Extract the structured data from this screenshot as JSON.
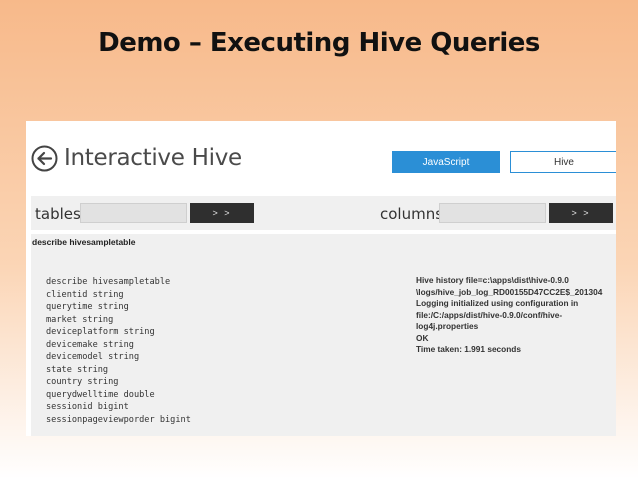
{
  "slide": {
    "title": "Demo – Executing Hive Queries"
  },
  "app": {
    "title": "Interactive Hive",
    "back_icon": "back-arrow-circle-icon",
    "modes": {
      "javascript": "JavaScript",
      "hive": "Hive",
      "selected": "JavaScript"
    },
    "accent_color": "#2b8fd6"
  },
  "toolbar": {
    "tables_label": "tables",
    "tables_value": "",
    "tables_go": "> >",
    "columns_label": "columns",
    "columns_value": "",
    "columns_go": "> >"
  },
  "output": {
    "command": "describe hivesampletable",
    "results": [
      "describe hivesampletable",
      "clientid string",
      "querytime string",
      "market string",
      "deviceplatform string",
      "devicemake string",
      "devicemodel string",
      "state string",
      "country string",
      "querydwelltime double",
      "sessionid bigint",
      "sessionpageviewporder bigint"
    ],
    "log": [
      "Hive history file=c:\\apps\\dist\\hive-0.9.0",
      "\\logs/hive_job_log_RD00155D47CC2E$_201304",
      "Logging initialized using configuration in",
      "file:/C:/apps/dist/hive-0.9.0/conf/hive-",
      "log4j.properties",
      "OK",
      "Time taken: 1.991 seconds"
    ]
  }
}
